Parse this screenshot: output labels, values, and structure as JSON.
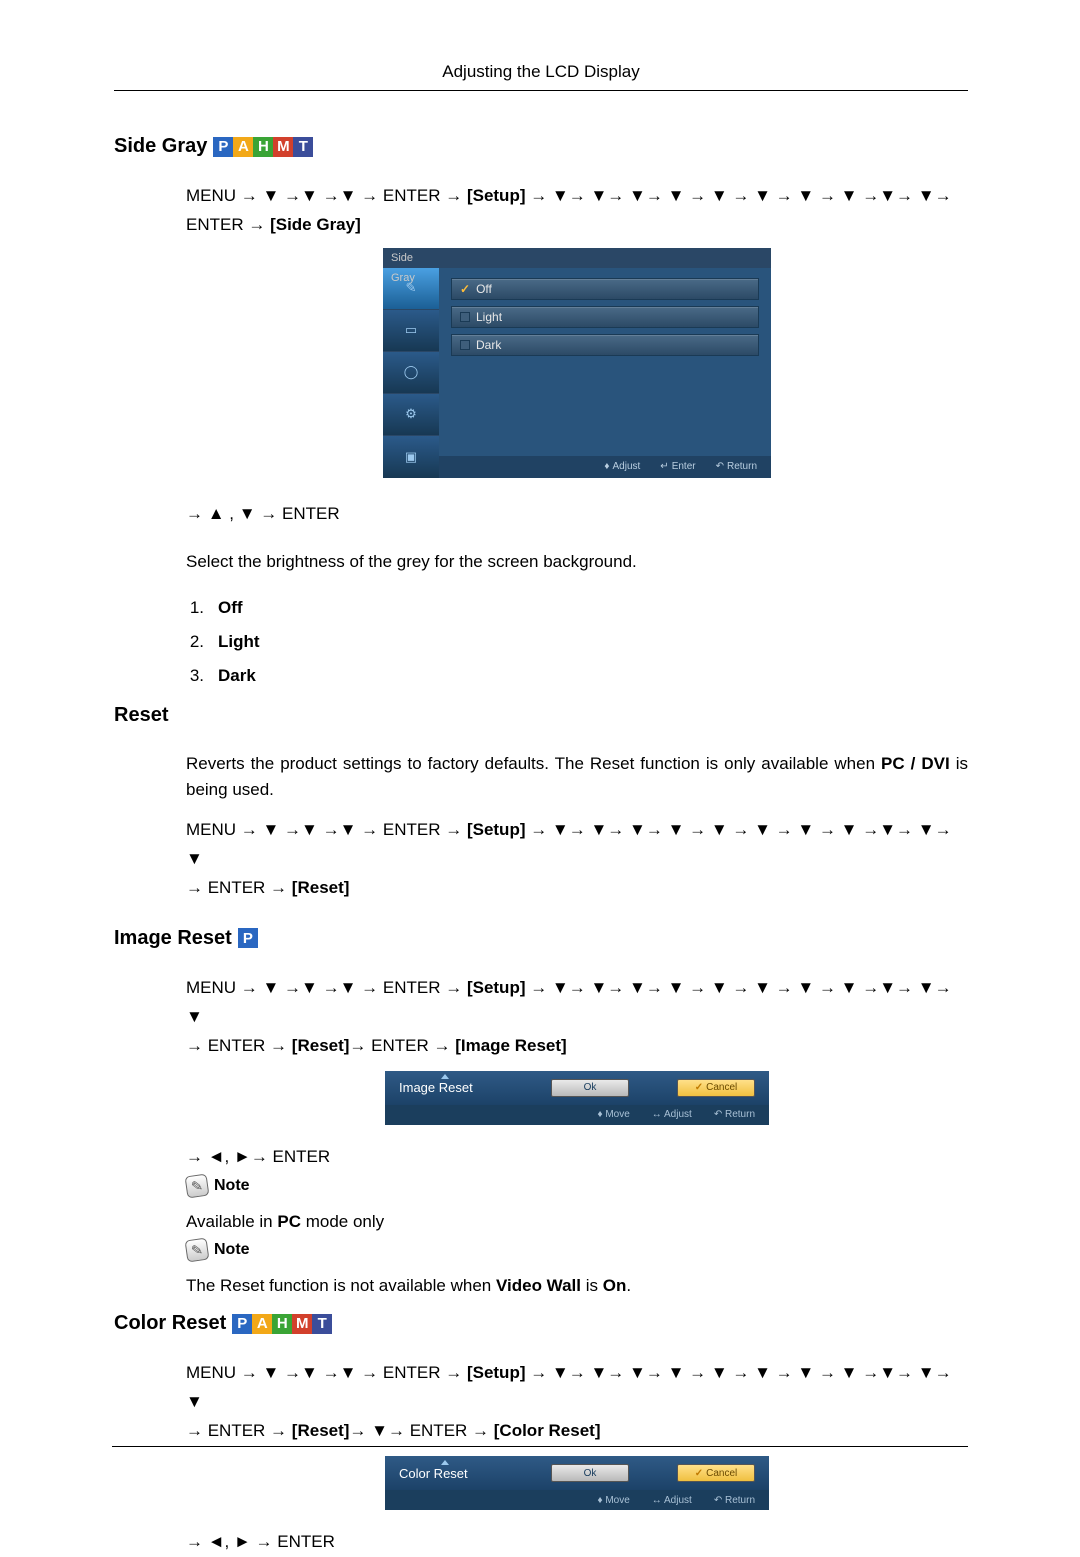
{
  "pageHeader": "Adjusting the LCD Display",
  "sideGray": {
    "title": "Side Gray",
    "chips": [
      "P",
      "A",
      "H",
      "M",
      "T"
    ],
    "navLine1_a": "MENU → ▼ →▼ →▼ → ENTER → ",
    "navLine1_bracket": "[Setup]",
    "navLine1_b": " → ▼→ ▼→ ▼→ ▼ → ▼ → ▼ → ▼ → ▼ →▼→ ▼→",
    "navLine2_a": "ENTER → ",
    "navLine2_bracket": "[Side Gray]",
    "osd": {
      "tabTitle": "Side Gray",
      "items": [
        "Off",
        "Light",
        "Dark"
      ],
      "footer": {
        "adjust": "Adjust",
        "enter": "Enter",
        "return": "Return"
      }
    },
    "navAfter": "→ ▲ ,  ▼ → ENTER",
    "description": "Select the brightness of the grey for the screen background.",
    "list": [
      "Off",
      "Light",
      "Dark"
    ]
  },
  "reset": {
    "title": "Reset",
    "body_a": "Reverts the product settings to factory defaults. The Reset function is only available when ",
    "body_bold": "PC / DVI",
    "body_b": " is being used.",
    "navLine1_a": "MENU → ▼ →▼ →▼ → ENTER → ",
    "navLine1_bracket": "[Setup]",
    "navLine1_b": " → ▼→ ▼→ ▼→ ▼ → ▼ → ▼ → ▼ → ▼ →▼→ ▼→ ▼",
    "navLine2_a": "→ ENTER → ",
    "navLine2_bracket": "[Reset]"
  },
  "imageReset": {
    "title": "Image Reset",
    "chips": [
      "P"
    ],
    "navLine1_a": "MENU → ▼ →▼ →▼ → ENTER → ",
    "navLine1_bracket": "[Setup]",
    "navLine1_b": " → ▼→ ▼→ ▼→ ▼ → ▼ → ▼ → ▼ → ▼ →▼→ ▼→ ▼",
    "navLine2_a": "→ ENTER → ",
    "navLine2_bracket1": "[Reset]",
    "navLine2_b": "→ ENTER → ",
    "navLine2_bracket2": "[Image Reset]",
    "dialog": {
      "title": "Image Reset",
      "ok": "Ok",
      "cancel": "Cancel",
      "footer": {
        "move": "Move",
        "adjust": "Adjust",
        "return": "Return"
      }
    },
    "navAfter": "→ ◄, ►→ ENTER",
    "noteLabel": "Note",
    "note1_a": "Available in ",
    "note1_bold": "PC",
    "note1_b": " mode only",
    "note2_a": "The Reset function is not available when ",
    "note2_bold": "Video Wall",
    "note2_b": " is ",
    "note2_bold2": "On",
    "note2_c": "."
  },
  "colorReset": {
    "title": "Color Reset",
    "chips": [
      "P",
      "A",
      "H",
      "M",
      "T"
    ],
    "navLine1_a": "MENU → ▼ →▼ →▼ → ENTER → ",
    "navLine1_bracket": "[Setup]",
    "navLine1_b": " → ▼→ ▼→ ▼→ ▼ → ▼ → ▼ → ▼ → ▼ →▼→ ▼→ ▼",
    "navLine2_a": "→ ENTER → ",
    "navLine2_bracket1": "[Reset]",
    "navLine2_b": "→ ▼→ ENTER → ",
    "navLine2_bracket2": "[Color Reset]",
    "dialog": {
      "title": "Color Reset",
      "ok": "Ok",
      "cancel": "Cancel",
      "footer": {
        "move": "Move",
        "adjust": "Adjust",
        "return": "Return"
      }
    },
    "navAfter": "→ ◄, ► → ENTER"
  }
}
